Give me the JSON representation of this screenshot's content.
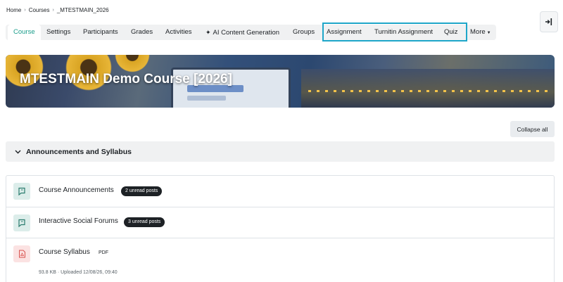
{
  "breadcrumb": {
    "items": [
      "Home",
      "Courses",
      "_MTESTMAIN_2026"
    ],
    "separator": "›"
  },
  "drawer": {
    "icon": "open-drawer-icon"
  },
  "nav": {
    "tabs": [
      {
        "label": "Course",
        "active": true
      },
      {
        "label": "Settings"
      },
      {
        "label": "Participants"
      },
      {
        "label": "Grades"
      },
      {
        "label": "Activities"
      },
      {
        "label": "AI Content Generation",
        "icon": "sparkle-icon"
      },
      {
        "label": "Groups"
      },
      {
        "label": "Assignment"
      },
      {
        "label": "Turnitin Assignment"
      },
      {
        "label": "Quiz"
      },
      {
        "label": "More",
        "icon": "caret-down-icon"
      }
    ],
    "accent_color": "#1a9d8b",
    "highlight_color": "#1ea6c9"
  },
  "banner": {
    "title": "MTESTMAIN Demo Course [2026]"
  },
  "controls": {
    "collapse_all": "Collapse all"
  },
  "section": {
    "title": "Announcements and Syllabus",
    "icon": "chevron-down-icon"
  },
  "activities": [
    {
      "name": "Course Announcements",
      "badge": "2 unread posts",
      "icon": "forum-icon"
    },
    {
      "name": "Interactive Social Forums",
      "badge": "3 unread posts",
      "icon": "forum-icon"
    },
    {
      "name": "Course Syllabus",
      "type": "PDF",
      "meta": "93.8 KB · Uploaded 12/08/26, 09:40",
      "icon": "pdf-icon"
    }
  ]
}
